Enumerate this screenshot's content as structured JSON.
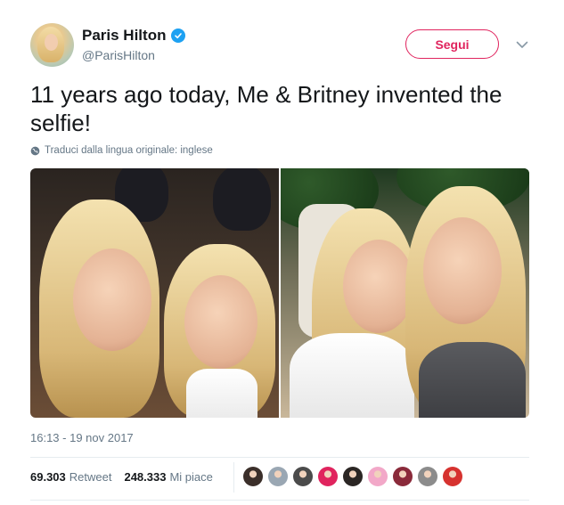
{
  "author": {
    "name": "Paris Hilton",
    "handle": "@ParisHilton",
    "verified": true,
    "avatar_icon": "profile-avatar"
  },
  "follow_button": {
    "label": "Segui",
    "color": "#e0245e"
  },
  "menu": {
    "icon": "chevron-down-icon"
  },
  "tweet": {
    "text": "11 years ago today, Me & Britney invented the selfie!",
    "translate_label": "Traduci dalla lingua originale: inglese",
    "media": [
      {
        "icon": "photo-left",
        "description_type": "image"
      },
      {
        "icon": "photo-right",
        "description_type": "image"
      }
    ],
    "timestamp": "16:13 - 19 nov 2017"
  },
  "stats": {
    "retweets_count": "69.303",
    "retweets_label": "Retweet",
    "likes_count": "248.333",
    "likes_label": "Mi piace"
  },
  "likers": [
    {
      "color": "#3b2f2a"
    },
    {
      "color": "#9aa7b3"
    },
    {
      "color": "#4b4b4b"
    },
    {
      "color": "#e0245e"
    },
    {
      "color": "#2b2624"
    },
    {
      "color": "#f2a8c8"
    },
    {
      "color": "#8a2a3a"
    },
    {
      "color": "#8c8c8c"
    },
    {
      "color": "#d6322f"
    }
  ],
  "colors": {
    "accent": "#1da1f2",
    "text": "#14171a",
    "muted": "#657786"
  }
}
